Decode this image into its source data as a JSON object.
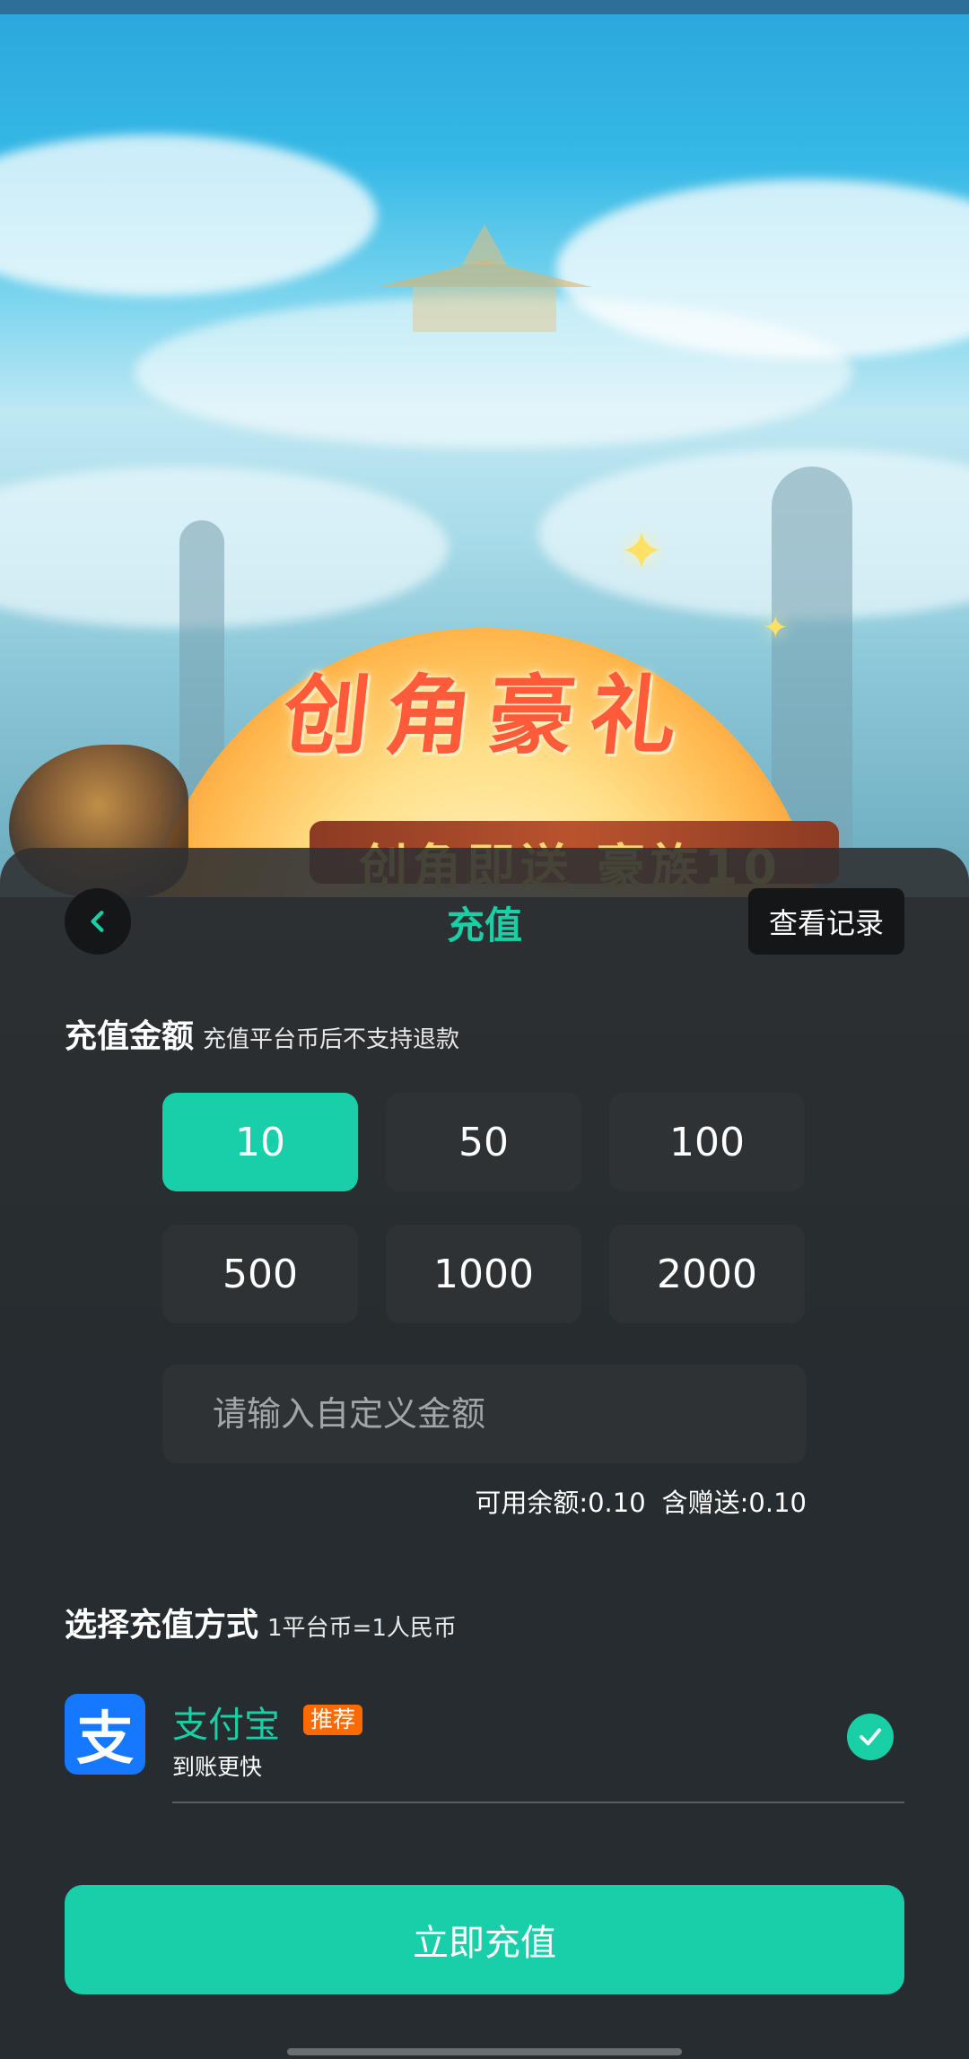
{
  "banner": {
    "headline": "创角豪礼",
    "ribbon_text": "创角即送 豪族10"
  },
  "header": {
    "title": "充值",
    "back_icon": "chevron-left-icon",
    "records_label": "查看记录"
  },
  "amount_section": {
    "label": "充值金额",
    "note": "充值平台币后不支持退款",
    "options": [
      "10",
      "50",
      "100",
      "500",
      "1000",
      "2000"
    ],
    "selected": "10",
    "custom_placeholder": "请输入自定义金额",
    "custom_value": "",
    "balance": "可用余额:0.10",
    "bonus": "含赠送:0.10"
  },
  "payment_section": {
    "label": "选择充值方式",
    "note": "1平台币=1人民币",
    "methods": [
      {
        "icon": "alipay-logo-icon",
        "logo_glyph": "支",
        "name": "支付宝",
        "badge": "推荐",
        "subtitle": "到账更快",
        "selected": true
      }
    ]
  },
  "submit_label": "立即充值",
  "colors": {
    "accent": "#19cfa9",
    "alipay_blue": "#1677ff",
    "badge_orange": "#ff6a00",
    "sheet_bg": "#282c2f",
    "button_dark": "#2f3235"
  }
}
